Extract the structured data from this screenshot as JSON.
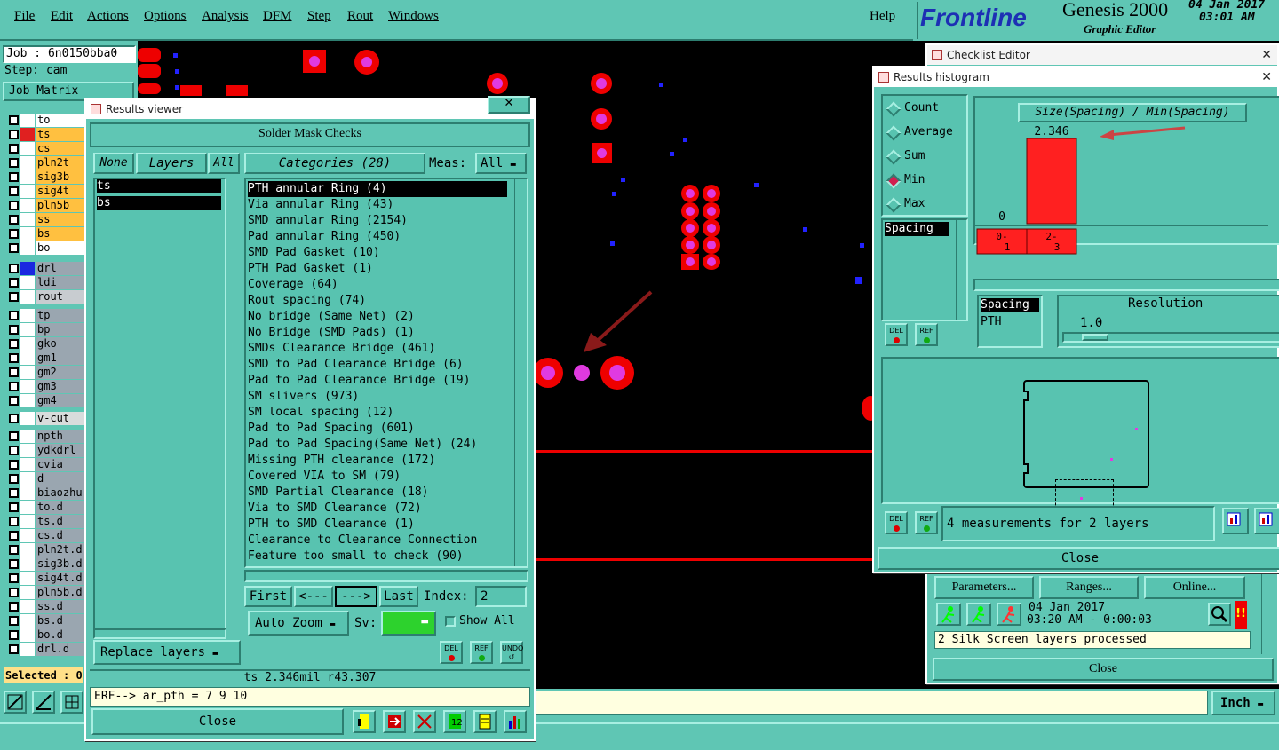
{
  "menubar": {
    "items": [
      "File",
      "Edit",
      "Actions",
      "Options",
      "Analysis",
      "DFM",
      "Step",
      "Rout",
      "Windows"
    ],
    "help": "Help"
  },
  "brand": {
    "logo": "Frontline",
    "product": "Genesis 2000",
    "subtitle": "Graphic Editor",
    "date": "04 Jan 2017",
    "time": "03:01 AM"
  },
  "job": {
    "job": "Job : 6n0150bba0",
    "step": "Step: cam",
    "matrix": "Job Matrix",
    "selected": "Selected : 0"
  },
  "layers": [
    {
      "name": "to",
      "color": "#ffffff",
      "sel": "#ffffff"
    },
    {
      "name": "ts",
      "color": "#ffc040",
      "sel": "#e02020"
    },
    {
      "name": "cs",
      "color": "#ffc040",
      "sel": "#ffffff"
    },
    {
      "name": "pln2t",
      "color": "#ffc040",
      "sel": "#ffffff"
    },
    {
      "name": "sig3b",
      "color": "#ffc040",
      "sel": "#ffffff"
    },
    {
      "name": "sig4t",
      "color": "#ffc040",
      "sel": "#ffffff"
    },
    {
      "name": "pln5b",
      "color": "#ffc040",
      "sel": "#ffffff"
    },
    {
      "name": "ss",
      "color": "#ffc040",
      "sel": "#ffffff"
    },
    {
      "name": "bs",
      "color": "#ffc040",
      "sel": "#ffffff"
    },
    {
      "name": "bo",
      "color": "#ffffff",
      "sel": "#ffffff"
    },
    {
      "name": "drl",
      "color": "#9aa6b0",
      "sel": "#1a28e0"
    },
    {
      "name": "ldi",
      "color": "#9aa6b0",
      "sel": "#ffffff"
    },
    {
      "name": "rout",
      "color": "#c8ccd0",
      "sel": "#ffffff"
    },
    {
      "name": "tp",
      "color": "#9aa6b0",
      "sel": "#ffffff"
    },
    {
      "name": "bp",
      "color": "#9aa6b0",
      "sel": "#ffffff"
    },
    {
      "name": "gko",
      "color": "#9aa6b0",
      "sel": "#ffffff"
    },
    {
      "name": "gm1",
      "color": "#9aa6b0",
      "sel": "#ffffff"
    },
    {
      "name": "gm2",
      "color": "#9aa6b0",
      "sel": "#ffffff"
    },
    {
      "name": "gm3",
      "color": "#9aa6b0",
      "sel": "#ffffff"
    },
    {
      "name": "gm4",
      "color": "#9aa6b0",
      "sel": "#ffffff"
    },
    {
      "name": "v-cut",
      "color": "#d8dcdc",
      "sel": "#ffffff"
    },
    {
      "name": "npth",
      "color": "#9aa6b0",
      "sel": "#ffffff"
    },
    {
      "name": "ydkdrl",
      "color": "#9aa6b0",
      "sel": "#ffffff"
    },
    {
      "name": "cvia",
      "color": "#9aa6b0",
      "sel": "#ffffff"
    },
    {
      "name": "d",
      "color": "#9aa6b0",
      "sel": "#ffffff"
    },
    {
      "name": "biaozhu",
      "color": "#9aa6b0",
      "sel": "#ffffff"
    },
    {
      "name": "to.d",
      "color": "#9aa6b0",
      "sel": "#ffffff"
    },
    {
      "name": "ts.d",
      "color": "#9aa6b0",
      "sel": "#ffffff"
    },
    {
      "name": "cs.d",
      "color": "#9aa6b0",
      "sel": "#ffffff"
    },
    {
      "name": "pln2t.d",
      "color": "#9aa6b0",
      "sel": "#ffffff"
    },
    {
      "name": "sig3b.d",
      "color": "#9aa6b0",
      "sel": "#ffffff"
    },
    {
      "name": "sig4t.d",
      "color": "#9aa6b0",
      "sel": "#ffffff"
    },
    {
      "name": "pln5b.d",
      "color": "#9aa6b0",
      "sel": "#ffffff"
    },
    {
      "name": "ss.d",
      "color": "#9aa6b0",
      "sel": "#ffffff"
    },
    {
      "name": "bs.d",
      "color": "#9aa6b0",
      "sel": "#ffffff"
    },
    {
      "name": "bo.d",
      "color": "#9aa6b0",
      "sel": "#ffffff"
    },
    {
      "name": "drl.d",
      "color": "#9aa6b0",
      "sel": "#ffffff"
    }
  ],
  "results_viewer": {
    "title": "Results viewer",
    "header": "Solder Mask Checks",
    "none": "None",
    "layers_label": "Layers",
    "all": "All",
    "layer_list": [
      "ts",
      "bs"
    ],
    "categories_label": "Categories (28)",
    "meas_label": "Meas:",
    "meas_value": "All",
    "categories": [
      "PTH annular Ring (4)",
      "Via annular Ring (43)",
      "SMD annular Ring (2154)",
      "Pad annular Ring (450)",
      "SMD Pad Gasket (10)",
      "PTH Pad Gasket (1)",
      "Coverage (64)",
      "Rout spacing (74)",
      "No bridge (Same Net) (2)",
      "No Bridge (SMD Pads) (1)",
      "SMDs Clearance Bridge (461)",
      "SMD to Pad Clearance Bridge (6)",
      "Pad to Pad Clearance Bridge (19)",
      "SM slivers (973)",
      "SM local spacing (12)",
      "Pad to Pad Spacing (601)",
      "Pad to Pad Spacing(Same Net) (24)",
      "Missing PTH clearance (172)",
      "Covered VIA to SM (79)",
      "SMD Partial Clearance (18)",
      "Via to SMD Clearance (72)",
      "PTH to SMD Clearance (1)",
      "Clearance to Clearance Connection",
      "Feature too small to check (90)"
    ],
    "first": "First",
    "prev": "<---",
    "next": "--->",
    "last": "Last",
    "index_label": "Index:",
    "index_value": "2",
    "auto_zoom": "Auto Zoom",
    "sv_label": "Sv:",
    "show_all": "Show All",
    "replace_layers": "Replace layers",
    "del": "DEL",
    "ref": "REF",
    "undo": "UNDO",
    "status": "ts 2.346mil   r43.307",
    "erf": "ERF--> ar_pth = 7 9 10",
    "close": "Close"
  },
  "checklist_editor": {
    "title": "Checklist Editor",
    "parameters": "Parameters...",
    "ranges": "Ranges...",
    "online": "Online...",
    "date": "04 Jan 2017",
    "time": "03:20 AM - 0:00:03",
    "status": "2 Silk Screen layers processed",
    "close": "Close"
  },
  "histogram": {
    "title": "Results histogram",
    "modes": [
      "Count",
      "Average",
      "Sum",
      "Min",
      "Max"
    ],
    "selected_mode": "Min",
    "chart_title": "Size(Spacing) / Min(Spacing)",
    "list_label": "Spacing",
    "list2": [
      "Spacing",
      "PTH"
    ],
    "resolution_label": "Resolution",
    "resolution_value": "1.0",
    "measurements": "4 measurements for 2 layers",
    "close": "Close",
    "del": "DEL",
    "ref": "REF"
  },
  "chart_data": {
    "type": "bar",
    "categories": [
      "0-1",
      "2-3"
    ],
    "values": [
      0,
      2.346
    ],
    "value_labels": [
      "0",
      "2.346"
    ],
    "title": "Size(Spacing) / Min(Spacing)",
    "xlabel": "",
    "ylabel": ""
  },
  "bottom": {
    "unit": "Inch"
  }
}
